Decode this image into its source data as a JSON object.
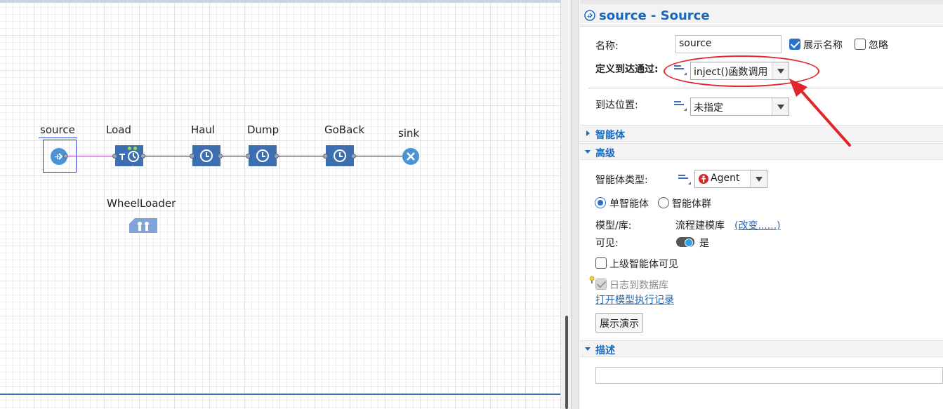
{
  "canvas": {
    "labels": {
      "source": "source",
      "load": "Load",
      "haul": "Haul",
      "dump": "Dump",
      "goback": "GoBack",
      "sink": "sink",
      "wheelloader": "WheelLoader"
    }
  },
  "panel": {
    "title": "source - Source",
    "name_label": "名称:",
    "name_value": "source",
    "show_name_label": "展示名称",
    "ignore_label": "忽略",
    "arrival_label": "定义到达通过:",
    "arrival_value": "inject()函数调用",
    "location_label": "到达位置:",
    "location_value": "未指定",
    "section_agent": "智能体",
    "section_advanced": "高级",
    "agent_type_label": "智能体类型:",
    "agent_type_value": "Agent",
    "single_agent_label": "单智能体",
    "agent_population_label": "智能体群",
    "model_library_label": "模型/库:",
    "model_library_value": "流程建模库",
    "change_link": "(改变......)",
    "visible_label": "可见:",
    "visible_value": "是",
    "upper_visible_label": "上级智能体可见",
    "log_db_label": "日志到数据库",
    "open_log_link": "打开模型执行记录",
    "show_demo_button": "展示演示",
    "section_description": "描述"
  },
  "colors": {
    "accent": "#1b67b8",
    "block": "#3d6fb0",
    "annotation": "#e0262b"
  }
}
